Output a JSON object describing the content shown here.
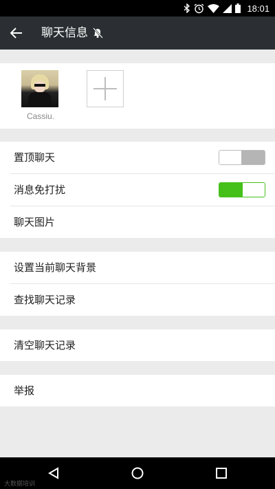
{
  "status_bar": {
    "time": "18:01",
    "icons": [
      "bluetooth-icon",
      "alarm-icon",
      "wifi-icon",
      "signal-icon",
      "battery-icon"
    ]
  },
  "app_bar": {
    "title": "聊天信息",
    "icons": [
      "back-arrow-icon",
      "mute-bell-icon"
    ]
  },
  "members": [
    {
      "name": "Cassiu."
    }
  ],
  "settings_groups": [
    {
      "items": [
        {
          "label": "置顶聊天",
          "toggle": "off"
        },
        {
          "label": "消息免打扰",
          "toggle": "on"
        },
        {
          "label": "聊天图片"
        }
      ]
    },
    {
      "items": [
        {
          "label": "设置当前聊天背景"
        },
        {
          "label": "查找聊天记录"
        }
      ]
    },
    {
      "items": [
        {
          "label": "清空聊天记录"
        }
      ]
    },
    {
      "items": [
        {
          "label": "举报"
        }
      ]
    }
  ],
  "nav_bar": {
    "icons": [
      "back-triangle-icon",
      "home-circle-icon",
      "recents-square-icon"
    ],
    "watermark": "大数据培训"
  },
  "colors": {
    "app_bar_bg": "#2b2f33",
    "toggle_on": "#45c01a",
    "toggle_off": "#b5b5b5",
    "page_bg": "#ebebeb"
  }
}
